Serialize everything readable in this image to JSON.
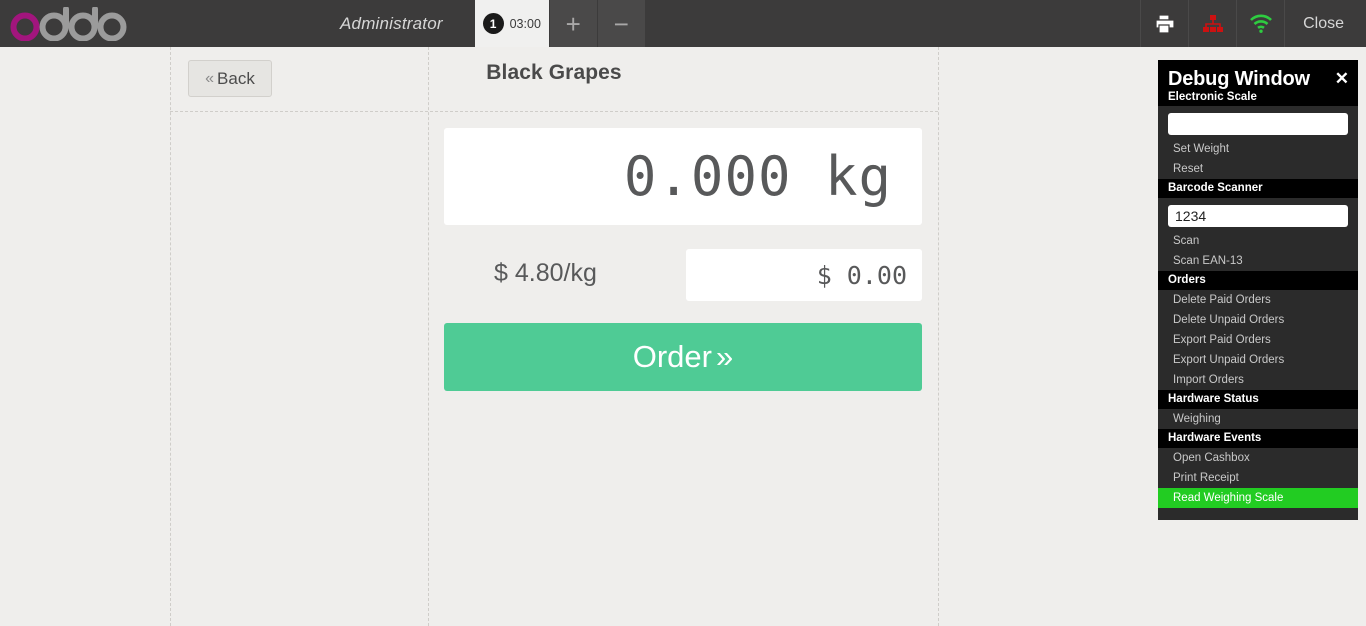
{
  "header": {
    "logo_text": "odoo",
    "logo_accent_color": "#a2157d",
    "username": "Administrator",
    "order_tab": {
      "badge": "1",
      "time": "03:00"
    },
    "add_label": "+",
    "remove_label": "−",
    "icons": [
      "printer-icon",
      "network-icon",
      "wifi-icon"
    ],
    "close_label": "Close"
  },
  "screen": {
    "back_label": "Back",
    "back_chevron": "«",
    "title": "Black Grapes",
    "weight_value": "0.000 kg",
    "unit_price": "$ 4.80/kg",
    "total_value": "$ 0.00",
    "order_label": "Order",
    "order_chevron": "»",
    "order_button_color": "#4fcb95"
  },
  "debug": {
    "title": "Debug Window",
    "close_glyph": "✕",
    "sections": [
      {
        "name": "Electronic Scale",
        "input": {
          "value": "",
          "placeholder": ""
        },
        "items": [
          "Set Weight",
          "Reset"
        ]
      },
      {
        "name": "Barcode Scanner",
        "input": {
          "value": "1234",
          "placeholder": ""
        },
        "items": [
          "Scan",
          "Scan EAN-13"
        ]
      },
      {
        "name": "Orders",
        "items": [
          "Delete Paid Orders",
          "Delete Unpaid Orders",
          "Export Paid Orders",
          "Export Unpaid Orders",
          "Import Orders"
        ]
      },
      {
        "name": "Hardware Status",
        "items": [
          "Weighing"
        ]
      },
      {
        "name": "Hardware Events",
        "items": [
          "Open Cashbox",
          "Print Receipt",
          "Read Weighing Scale"
        ]
      }
    ],
    "active_item": "Read Weighing Scale",
    "active_color": "#22cc22"
  }
}
